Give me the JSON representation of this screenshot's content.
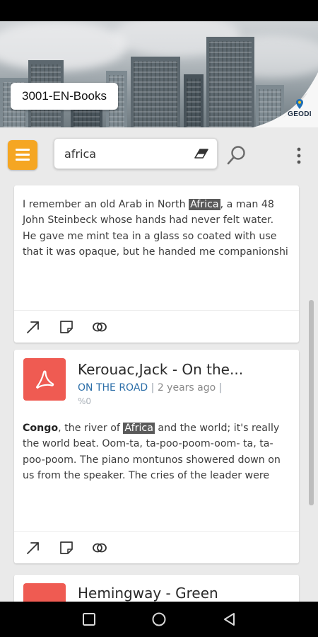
{
  "header": {
    "library_name": "3001-EN-Books",
    "logo_text": "GEODI"
  },
  "toolbar": {
    "menu_icon": "hamburger-menu-icon",
    "search_value": "africa",
    "clear_icon": "eraser-icon",
    "search_icon": "magnifier-icon",
    "more_icon": "vertical-dots-icon",
    "accent_color": "#f5a623"
  },
  "results": [
    {
      "snippet": {
        "before": "I remember an old Arab in North ",
        "highlight": "Africa",
        "after": ", a man 48 John Steinbeck whose hands had never felt water. He gave me mint tea in a glass so coated with use that it was opaque, but he handed me companionshi"
      },
      "actions": [
        "open-external-icon",
        "note-icon",
        "related-icon"
      ]
    },
    {
      "icon": "pdf-icon",
      "title": "Kerouac,Jack - On the...",
      "subtitle": "ON THE ROAD",
      "separator": "|",
      "date": "2 years ago",
      "separator2": "|",
      "percent": "%0",
      "snippet": {
        "bold": "Congo",
        "before": ", the river of ",
        "highlight": "Africa",
        "after": " and the world; it's really the world beat. Oom-ta, ta-poo-poom-oom- ta, ta-poo-poom. The piano montunos showered down on us from the speaker. The cries of the leader were"
      },
      "actions": [
        "open-external-icon",
        "note-icon",
        "related-icon"
      ]
    },
    {
      "icon": "pdf-icon",
      "title": "Hemingway - Green"
    }
  ],
  "system_nav": {
    "recent": "recent-apps-icon",
    "home": "home-icon",
    "back": "back-icon"
  }
}
